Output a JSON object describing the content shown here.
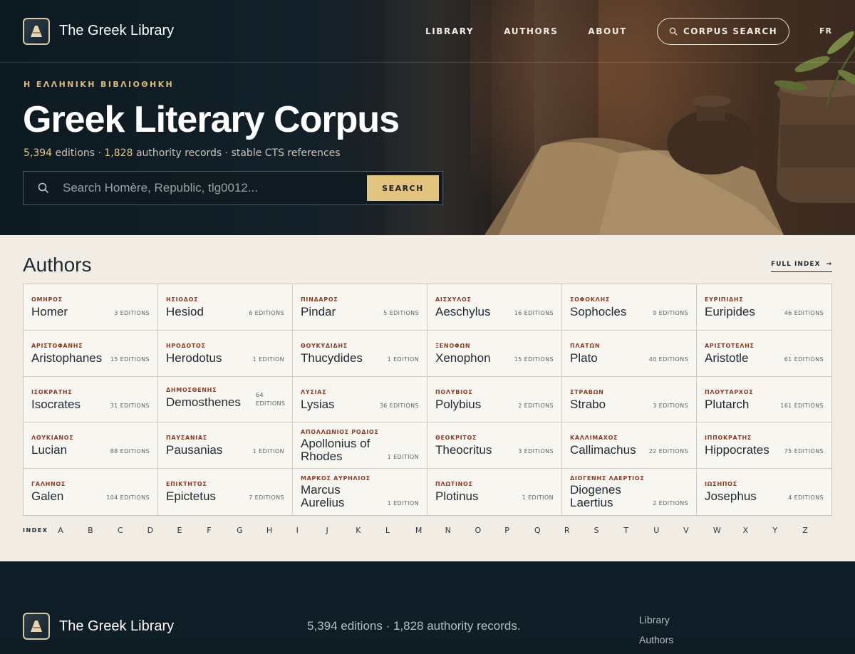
{
  "brand": {
    "name": "The Greek Library"
  },
  "nav": {
    "library": "LIBRARY",
    "authors": "AUTHORS",
    "about": "ABOUT",
    "corpus_search": "CORPUS SEARCH",
    "lang": "FR"
  },
  "hero": {
    "eyebrow": "Η ΕΛΛΗΝΙΚΗ ΒΙΒΛΙΟΘΗΚΗ",
    "title": "Greek Literary Corpus",
    "stats_editions_num": "5,394",
    "stats_editions_label": " editions · ",
    "stats_records_num": "1,828",
    "stats_records_label": " authority records · stable CTS references",
    "search_placeholder": "Search Homère, Republic, tlg0012...",
    "search_button": "SEARCH"
  },
  "authors": {
    "heading": "Authors",
    "full_index": "FULL INDEX",
    "list": [
      {
        "greek": "ΟΜΗΡΟΣ",
        "name": "Homer",
        "editions": "3 EDITIONS"
      },
      {
        "greek": "ΗΣΙΟΔΟΣ",
        "name": "Hesiod",
        "editions": "6 EDITIONS"
      },
      {
        "greek": "ΠΙΝΔΑΡΟΣ",
        "name": "Pindar",
        "editions": "5 EDITIONS"
      },
      {
        "greek": "ΑΙΣΧΥΛΟΣ",
        "name": "Aeschylus",
        "editions": "16 EDITIONS"
      },
      {
        "greek": "ΣΟΦΟΚΛΗΣ",
        "name": "Sophocles",
        "editions": "9 EDITIONS"
      },
      {
        "greek": "ΕΥΡΙΠΙΔΗΣ",
        "name": "Euripides",
        "editions": "46 EDITIONS"
      },
      {
        "greek": "ΑΡΙΣΤΟΦΑΝΗΣ",
        "name": "Aristophanes",
        "editions": "15 EDITIONS"
      },
      {
        "greek": "ΗΡΟΔΟΤΟΣ",
        "name": "Herodotus",
        "editions": "1 EDITION"
      },
      {
        "greek": "ΘΟΥΚΥΔΙΔΗΣ",
        "name": "Thucydides",
        "editions": "1 EDITION"
      },
      {
        "greek": "ΞΕΝΟΦΩΝ",
        "name": "Xenophon",
        "editions": "15 EDITIONS"
      },
      {
        "greek": "ΠΛΑΤΩΝ",
        "name": "Plato",
        "editions": "40 EDITIONS"
      },
      {
        "greek": "ΑΡΙΣΤΟΤΕΛΗΣ",
        "name": "Aristotle",
        "editions": "61 EDITIONS"
      },
      {
        "greek": "ΙΣΟΚΡΑΤΗΣ",
        "name": "Isocrates",
        "editions": "31 EDITIONS"
      },
      {
        "greek": "ΔΗΜΟΣΘΕΝΗΣ",
        "name": "Demosthenes",
        "editions": "64 EDITIONS"
      },
      {
        "greek": "ΛΥΣΙΑΣ",
        "name": "Lysias",
        "editions": "36 EDITIONS"
      },
      {
        "greek": "ΠΟΛΥΒΙΟΣ",
        "name": "Polybius",
        "editions": "2 EDITIONS"
      },
      {
        "greek": "ΣΤΡΑΒΩΝ",
        "name": "Strabo",
        "editions": "3 EDITIONS"
      },
      {
        "greek": "ΠΛΟΥΤΑΡΧΟΣ",
        "name": "Plutarch",
        "editions": "161 EDITIONS"
      },
      {
        "greek": "ΛΟΥΚΙΑΝΟΣ",
        "name": "Lucian",
        "editions": "88 EDITIONS"
      },
      {
        "greek": "ΠΑΥΣΑΝΙΑΣ",
        "name": "Pausanias",
        "editions": "1 EDITION"
      },
      {
        "greek": "ΑΠΟΛΛΩΝΙΟΣ ΡΟΔΙΟΣ",
        "name": "Apollonius of Rhodes",
        "editions": "1 EDITION"
      },
      {
        "greek": "ΘΕΟΚΡΙΤΟΣ",
        "name": "Theocritus",
        "editions": "3 EDITIONS"
      },
      {
        "greek": "ΚΑΛΛΙΜΑΧΟΣ",
        "name": "Callimachus",
        "editions": "22 EDITIONS"
      },
      {
        "greek": "ΙΠΠΟΚΡΑΤΗΣ",
        "name": "Hippocrates",
        "editions": "75 EDITIONS"
      },
      {
        "greek": "ΓΑΛΗΝΟΣ",
        "name": "Galen",
        "editions": "104 EDITIONS"
      },
      {
        "greek": "ΕΠΙΚΤΗΤΟΣ",
        "name": "Epictetus",
        "editions": "7 EDITIONS"
      },
      {
        "greek": "ΜΑΡΚΟΣ ΑΥΡΗΛΙΟΣ",
        "name": "Marcus Aurelius",
        "editions": "1 EDITION"
      },
      {
        "greek": "ΠΛΩΤΙΝΟΣ",
        "name": "Plotinus",
        "editions": "1 EDITION"
      },
      {
        "greek": "ΔΙΟΓΕΝΗΣ ΛΑΕΡΤΙΟΣ",
        "name": "Diogenes Laertius",
        "editions": "2 EDITIONS"
      },
      {
        "greek": "ΙΩΣΗΠΟΣ",
        "name": "Josephus",
        "editions": "4 EDITIONS"
      }
    ],
    "index_label": "INDEX",
    "letters": [
      "A",
      "B",
      "C",
      "D",
      "E",
      "F",
      "G",
      "H",
      "I",
      "J",
      "K",
      "L",
      "M",
      "N",
      "O",
      "P",
      "Q",
      "R",
      "S",
      "T",
      "U",
      "V",
      "W",
      "X",
      "Y",
      "Z"
    ]
  },
  "footer": {
    "stats": "5,394 editions · 1,828 authority records.",
    "links": [
      "Library",
      "Authors"
    ]
  }
}
